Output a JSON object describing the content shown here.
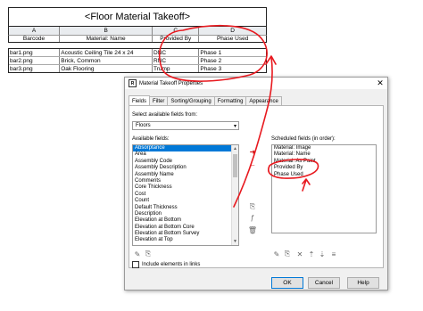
{
  "schedule": {
    "title": "<Floor Material Takeoff>",
    "column_letters": [
      "A",
      "B",
      "C",
      "D"
    ],
    "headers": [
      "Barcode",
      "Material: Name",
      "Provided By",
      "Phase Used"
    ],
    "rows": [
      [
        "bar1.png",
        "Acoustic Ceiling Tile 24 x 24",
        "DNC",
        "Phase 1"
      ],
      [
        "bar2.png",
        "Brick, Common",
        "RNC",
        "Phase 2"
      ],
      [
        "bar3.png",
        "Oak Flooring",
        "Trump",
        "Phase 3"
      ]
    ]
  },
  "dialog": {
    "title": "Material Takeoff Properties",
    "close_glyph": "✕",
    "tabs": [
      "Fields",
      "Filter",
      "Sorting/Grouping",
      "Formatting",
      "Appearance"
    ],
    "active_tab": "Fields",
    "select_fields_from_label": "Select available fields from:",
    "select_fields_from_value": "Floors",
    "available_fields_label": "Available fields:",
    "available_fields": [
      "Absorptance",
      "Area",
      "Assembly Code",
      "Assembly Description",
      "Assembly Name",
      "Comments",
      "Core Thickness",
      "Cost",
      "Count",
      "Default Thickness",
      "Description",
      "Elevation at Bottom",
      "Elevation at Bottom Core",
      "Elevation at Bottom Survey",
      "Elevation at Top"
    ],
    "selected_available": "Absorptance",
    "scheduled_fields_label": "Scheduled fields (in order):",
    "scheduled_fields": [
      "Material: Image",
      "Material: Name",
      "Material: As Paint",
      "Provided By",
      "Phase Used"
    ],
    "include_links_label": "Include elements in links",
    "buttons": {
      "ok": "OK",
      "cancel": "Cancel",
      "help": "Help"
    }
  },
  "colors": {
    "annotation": "#e8191f",
    "selection": "#0078d7"
  }
}
